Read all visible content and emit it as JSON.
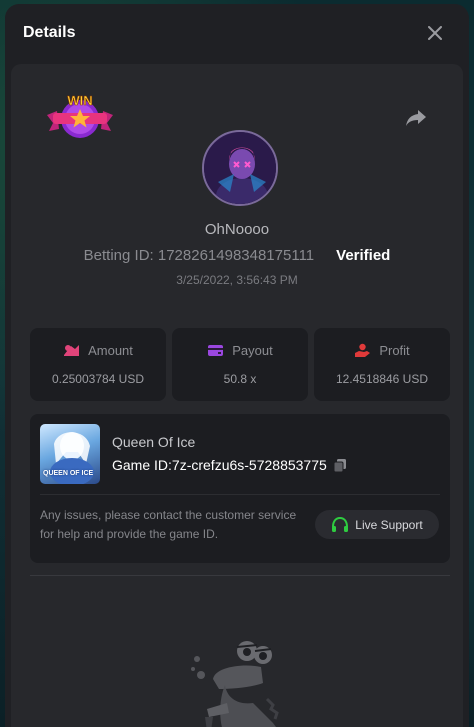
{
  "modal": {
    "title": "Details"
  },
  "bet": {
    "badge_label": "WIN",
    "username": "OhNoooo",
    "betting_id_text": "Betting ID: 1728261498348175111",
    "verified_label": "Verified",
    "timestamp": "3/25/2022, 3:56:43 PM"
  },
  "stats": [
    {
      "label": "Amount",
      "value": "0.25003784 USD",
      "icon": "amount-icon",
      "color": "#e0447a"
    },
    {
      "label": "Payout",
      "value": "50.8 x",
      "icon": "wallet-icon",
      "color": "#9b47e0"
    },
    {
      "label": "Profit",
      "value": "12.4518846 USD",
      "icon": "profit-hand-icon",
      "color": "#e03a3a"
    }
  ],
  "game": {
    "name": "Queen Of Ice",
    "id_text": "Game ID:7z-crefzu6s-5728853775",
    "thumb_text": "QUEEN OF ICE"
  },
  "support": {
    "help_text": "Any issues, please contact the customer service for help and provide the game ID.",
    "button_label": "Live Support",
    "icon_color": "#2ecc40"
  }
}
